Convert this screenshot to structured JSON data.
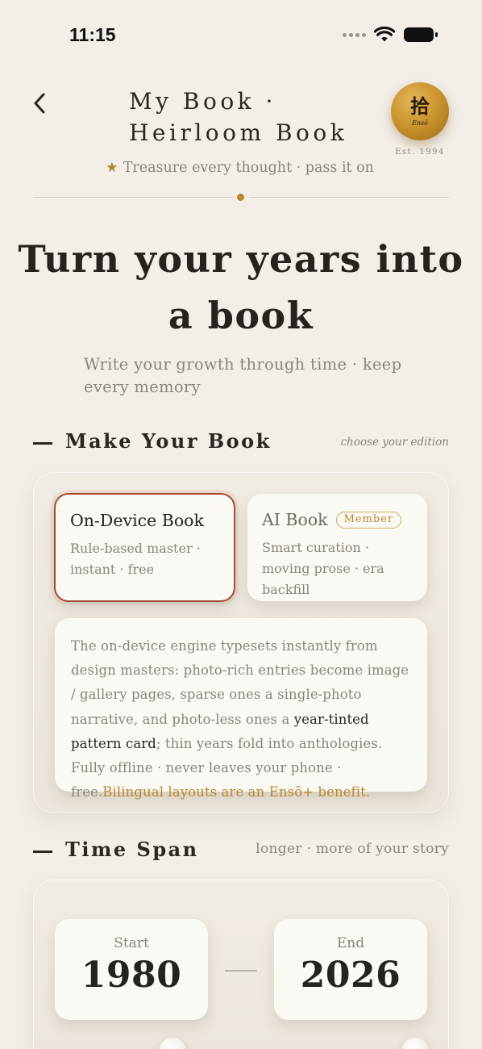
{
  "status_bar": {
    "time": "11:15"
  },
  "header": {
    "title": "My Book · Heirloom Book",
    "seal_glyph": "拾",
    "seal_script": "Ensō",
    "est": "Est. 1994",
    "tagline_star": "★",
    "tagline": "Treasure every thought · pass it on"
  },
  "hero": {
    "title": "Turn your years into a book",
    "subtitle": "Write your growth through time · keep every memory"
  },
  "make_book": {
    "section_title": "Make Your Book",
    "section_hint": "choose your edition",
    "editions": [
      {
        "title": "On-Device Book",
        "description": "Rule-based master · instant · free",
        "selected": true
      },
      {
        "title": "AI Book",
        "badge": "Member",
        "description": "Smart curation · moving prose · era backfill",
        "selected": false
      }
    ],
    "description": {
      "part1": "The on-device engine typesets instantly from design masters: photo-rich entries become image / gallery pages, sparse ones a single-photo narrative, and photo-less ones a ",
      "highlight": "year-tinted pattern card",
      "part2": "; thin years fold into anthologies. Fully offline · never leaves your phone · free.",
      "gold": "Bilingual layouts are an Ensō+ benefit."
    }
  },
  "time_span": {
    "section_title": "Time Span",
    "section_hint": "longer · more of your story",
    "start_label": "Start",
    "start_year": "1980",
    "end_label": "End",
    "end_year": "2026"
  },
  "colors": {
    "background": "#f3efe8",
    "accent_gold": "#b8862c",
    "selected_border": "#a54a36",
    "text_dark": "#2a2622",
    "text_muted": "#8a847b"
  },
  "icons": {
    "back": "chevron-left-icon",
    "signal": "cellular-signal-icon",
    "wifi": "wifi-icon",
    "battery": "battery-icon"
  }
}
